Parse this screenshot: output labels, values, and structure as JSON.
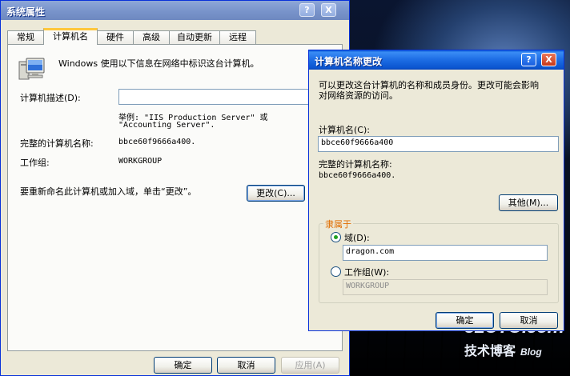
{
  "desktop": {
    "watermark_top": "51CTO.com",
    "watermark_bottom": "技术博客",
    "watermark_blog": "Blog"
  },
  "sys_props": {
    "title": "系统属性",
    "help_btn": "?",
    "close_btn": "X",
    "tabs": [
      "常规",
      "计算机名",
      "硬件",
      "高级",
      "自动更新",
      "远程"
    ],
    "active_tab": "计算机名",
    "intro": "Windows 使用以下信息在网络中标识这台计算机。",
    "desc_label": "计算机描述(D):",
    "desc_value": "",
    "example_line1": "举例: \"IIS Production Server\" 或",
    "example_line2": "\"Accounting Server\".",
    "fullname_label": "完整的计算机名称:",
    "fullname_value": "bbce60f9666a400.",
    "workgroup_label": "工作组:",
    "workgroup_value": "WORKGROUP",
    "rename_text": "要重新命名此计算机或加入域，单击“更改”。",
    "change_btn": "更改(C)...",
    "ok_btn": "确定",
    "cancel_btn": "取消",
    "apply_btn": "应用(A)"
  },
  "rename_dialog": {
    "title": "计算机名称更改",
    "help_btn": "?",
    "close_btn": "X",
    "info_line1": "可以更改这台计算机的名称和成员身份。更改可能会影响",
    "info_line2": "对网络资源的访问。",
    "name_label": "计算机名(C):",
    "name_value": "bbce60f9666a400",
    "fullname_label": "完整的计算机名称:",
    "fullname_value": "bbce60f9666a400.",
    "more_btn": "其他(M)...",
    "member_group_title": "隶属于",
    "domain_label": "域(D):",
    "domain_value": "dragon.com",
    "domain_selected": true,
    "workgroup_label": "工作组(W):",
    "workgroup_value": "WORKGROUP",
    "ok_btn": "确定",
    "cancel_btn": "取消"
  },
  "colors": {
    "title_active": "#0b55d0",
    "group_title": "#e06d00",
    "dialog_bg": "#ece9d8",
    "tab_highlight": "#ffc73c"
  }
}
